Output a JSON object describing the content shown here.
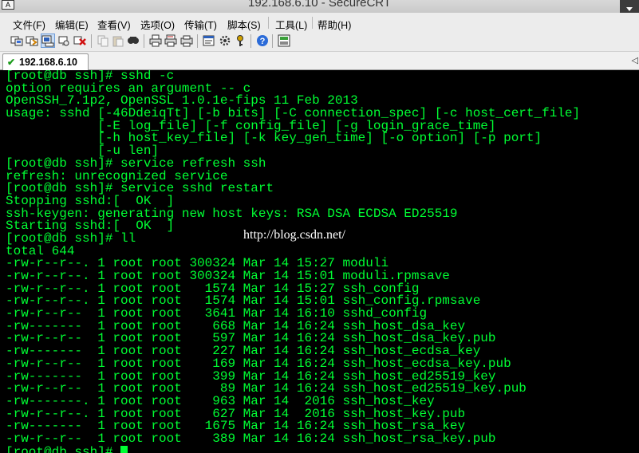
{
  "window": {
    "title": "192.168.6.10 - SecureCRT",
    "app_icon_text": "A"
  },
  "menu": [
    "文件(F)",
    "编辑(E)",
    "查看(V)",
    "选项(O)",
    "传输(T)",
    "脚本(S)",
    "工具(L)",
    "帮助(H)"
  ],
  "toolbar": {
    "icons": [
      "connect-icon",
      "quick-connect-icon",
      "connect-tab-icon",
      "reconnect-icon",
      "disconnect-icon",
      "copy-icon",
      "paste-icon",
      "find-icon",
      "print-icon",
      "print-selection-icon",
      "print-setup-icon",
      "session-options-icon",
      "global-options-icon",
      "keymap-icon",
      "help-icon",
      "sftp-icon"
    ]
  },
  "tab": {
    "label": "192.168.6.10",
    "status_icon": "connected-check-icon"
  },
  "terminal": {
    "lines": [
      "[root@db ssh]# sshd -c",
      "option requires an argument -- c",
      "OpenSSH_7.1p2, OpenSSL 1.0.1e-fips 11 Feb 2013",
      "usage: sshd [-46DdeiqTt] [-b bits] [-C connection_spec] [-c host_cert_file]",
      "            [-E log_file] [-f config_file] [-g login_grace_time]",
      "            [-h host_key_file] [-k key_gen_time] [-o option] [-p port]",
      "            [-u len]",
      "[root@db ssh]# service refresh ssh",
      "refresh: unrecognized service",
      "[root@db ssh]# service sshd restart",
      "Stopping sshd:[  OK  ]",
      "ssh-keygen: generating new host keys: RSA DSA ECDSA ED25519",
      "Starting sshd:[  OK  ]",
      "[root@db ssh]# ll",
      "total 644",
      "-rw-r--r--. 1 root root 300324 Mar 14 15:27 moduli",
      "-rw-r--r--. 1 root root 300324 Mar 14 15:01 moduli.rpmsave",
      "-rw-r--r--. 1 root root   1574 Mar 14 15:27 ssh_config",
      "-rw-r--r--. 1 root root   1574 Mar 14 15:01 ssh_config.rpmsave",
      "-rw-r--r--  1 root root   3641 Mar 14 16:10 sshd_config",
      "-rw-------  1 root root    668 Mar 14 16:24 ssh_host_dsa_key",
      "-rw-r--r--  1 root root    597 Mar 14 16:24 ssh_host_dsa_key.pub",
      "-rw-------  1 root root    227 Mar 14 16:24 ssh_host_ecdsa_key",
      "-rw-r--r--  1 root root    169 Mar 14 16:24 ssh_host_ecdsa_key.pub",
      "-rw-------  1 root root    399 Mar 14 16:24 ssh_host_ed25519_key",
      "-rw-r--r--  1 root root     89 Mar 14 16:24 ssh_host_ed25519_key.pub",
      "-rw-------. 1 root root    963 Mar 14  2016 ssh_host_key",
      "-rw-r--r--. 1 root root    627 Mar 14  2016 ssh_host_key.pub",
      "-rw-------  1 root root   1675 Mar 14 16:24 ssh_host_rsa_key",
      "-rw-r--r--  1 root root    389 Mar 14 16:24 ssh_host_rsa_key.pub"
    ],
    "prompt": "[root@db ssh]# ",
    "watermark": "http://blog.csdn.net/",
    "colors": {
      "background": "#000000",
      "foreground": "#00ff33"
    }
  }
}
